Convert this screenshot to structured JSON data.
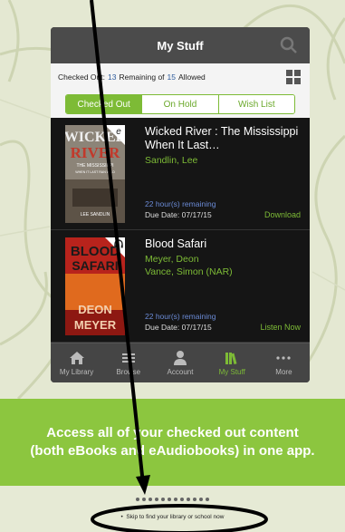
{
  "app": {
    "title": "My Stuff",
    "search_icon": "search-icon",
    "grid_icon": "grid-icon"
  },
  "counts": {
    "prefix": "Checked Out:",
    "checked_out": "13",
    "middle": "Remaining of",
    "remaining_of": "15",
    "suffix": "Allowed"
  },
  "tabs": [
    {
      "label": "Checked Out",
      "active": true
    },
    {
      "label": "On Hold",
      "active": false
    },
    {
      "label": "Wish List",
      "active": false
    }
  ],
  "items": [
    {
      "title": "Wicked River : The Mississippi When It Last…",
      "authors": [
        "Sandlin, Lee"
      ],
      "remaining": "22 hour(s) remaining",
      "due": "Due Date: 07/17/15",
      "action": "Download",
      "cover_text": [
        "WICKED",
        "RIVER",
        "THE MISSISSIPPI",
        "WHEN IT LAST RAN WILD",
        "LEE SANDLIN"
      ],
      "format_icon": "ebook-badge-icon"
    },
    {
      "title": "Blood Safari",
      "authors": [
        "Meyer, Deon",
        "Vance, Simon (NAR)"
      ],
      "remaining": "22 hour(s) remaining",
      "due": "Due Date: 07/17/15",
      "action": "Listen Now",
      "cover_text": [
        "BLOOD",
        "SAFARI",
        "DEON",
        "MEYER"
      ],
      "format_icon": "headphones-icon"
    }
  ],
  "nav": [
    {
      "label": "My Library",
      "icon": "home-icon",
      "active": false
    },
    {
      "label": "Browse",
      "icon": "list-icon",
      "active": false
    },
    {
      "label": "Account",
      "icon": "person-icon",
      "active": false
    },
    {
      "label": "My Stuff",
      "icon": "books-icon",
      "active": true
    },
    {
      "label": "More",
      "icon": "more-icon",
      "active": false
    }
  ],
  "banner": {
    "text": "Access all of your checked out content (both eBooks and eAudiobooks) in one app."
  },
  "skip": {
    "text": "Skip to find your library or school now"
  },
  "colors": {
    "accent": "#7dbb36",
    "banner": "#8cc63f",
    "header": "#4b4b4b"
  }
}
